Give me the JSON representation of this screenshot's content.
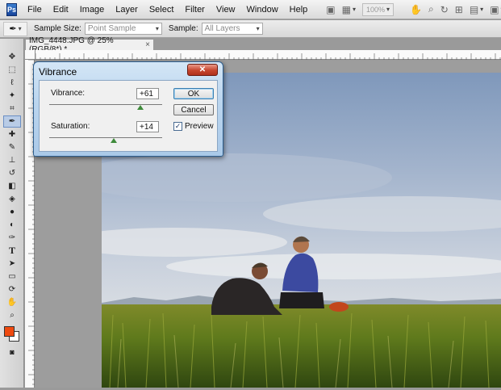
{
  "app": {
    "logo": "Ps"
  },
  "menu": [
    "File",
    "Edit",
    "Image",
    "Layer",
    "Select",
    "Filter",
    "View",
    "Window",
    "Help"
  ],
  "menubar_icons": [
    "bridge-icon",
    "screen-mode-icon",
    "hand-icon",
    "zoom-icon",
    "rotate-icon",
    "grid-icon",
    "arrange-icon",
    "screen-icon"
  ],
  "zoom_level": "100%",
  "options": {
    "sample_size_label": "Sample Size:",
    "sample_size_value": "Point Sample",
    "sample_label": "Sample:",
    "sample_value": "All Layers"
  },
  "document": {
    "tab_title": "IMG_4448.JPG @ 25% (RGB/8*) *",
    "close": "×"
  },
  "dialog": {
    "title": "Vibrance",
    "close": "✕",
    "vibrance_label": "Vibrance:",
    "vibrance_value": "+61",
    "vibrance_fraction": 0.805,
    "saturation_label": "Saturation:",
    "saturation_value": "+14",
    "saturation_fraction": 0.57,
    "ok_label": "OK",
    "cancel_label": "Cancel",
    "preview_label": "Preview",
    "preview_checked": true
  },
  "colors": {
    "foreground": "#ef4a10",
    "background": "#ffffff",
    "accent": "#3c7fb1"
  }
}
